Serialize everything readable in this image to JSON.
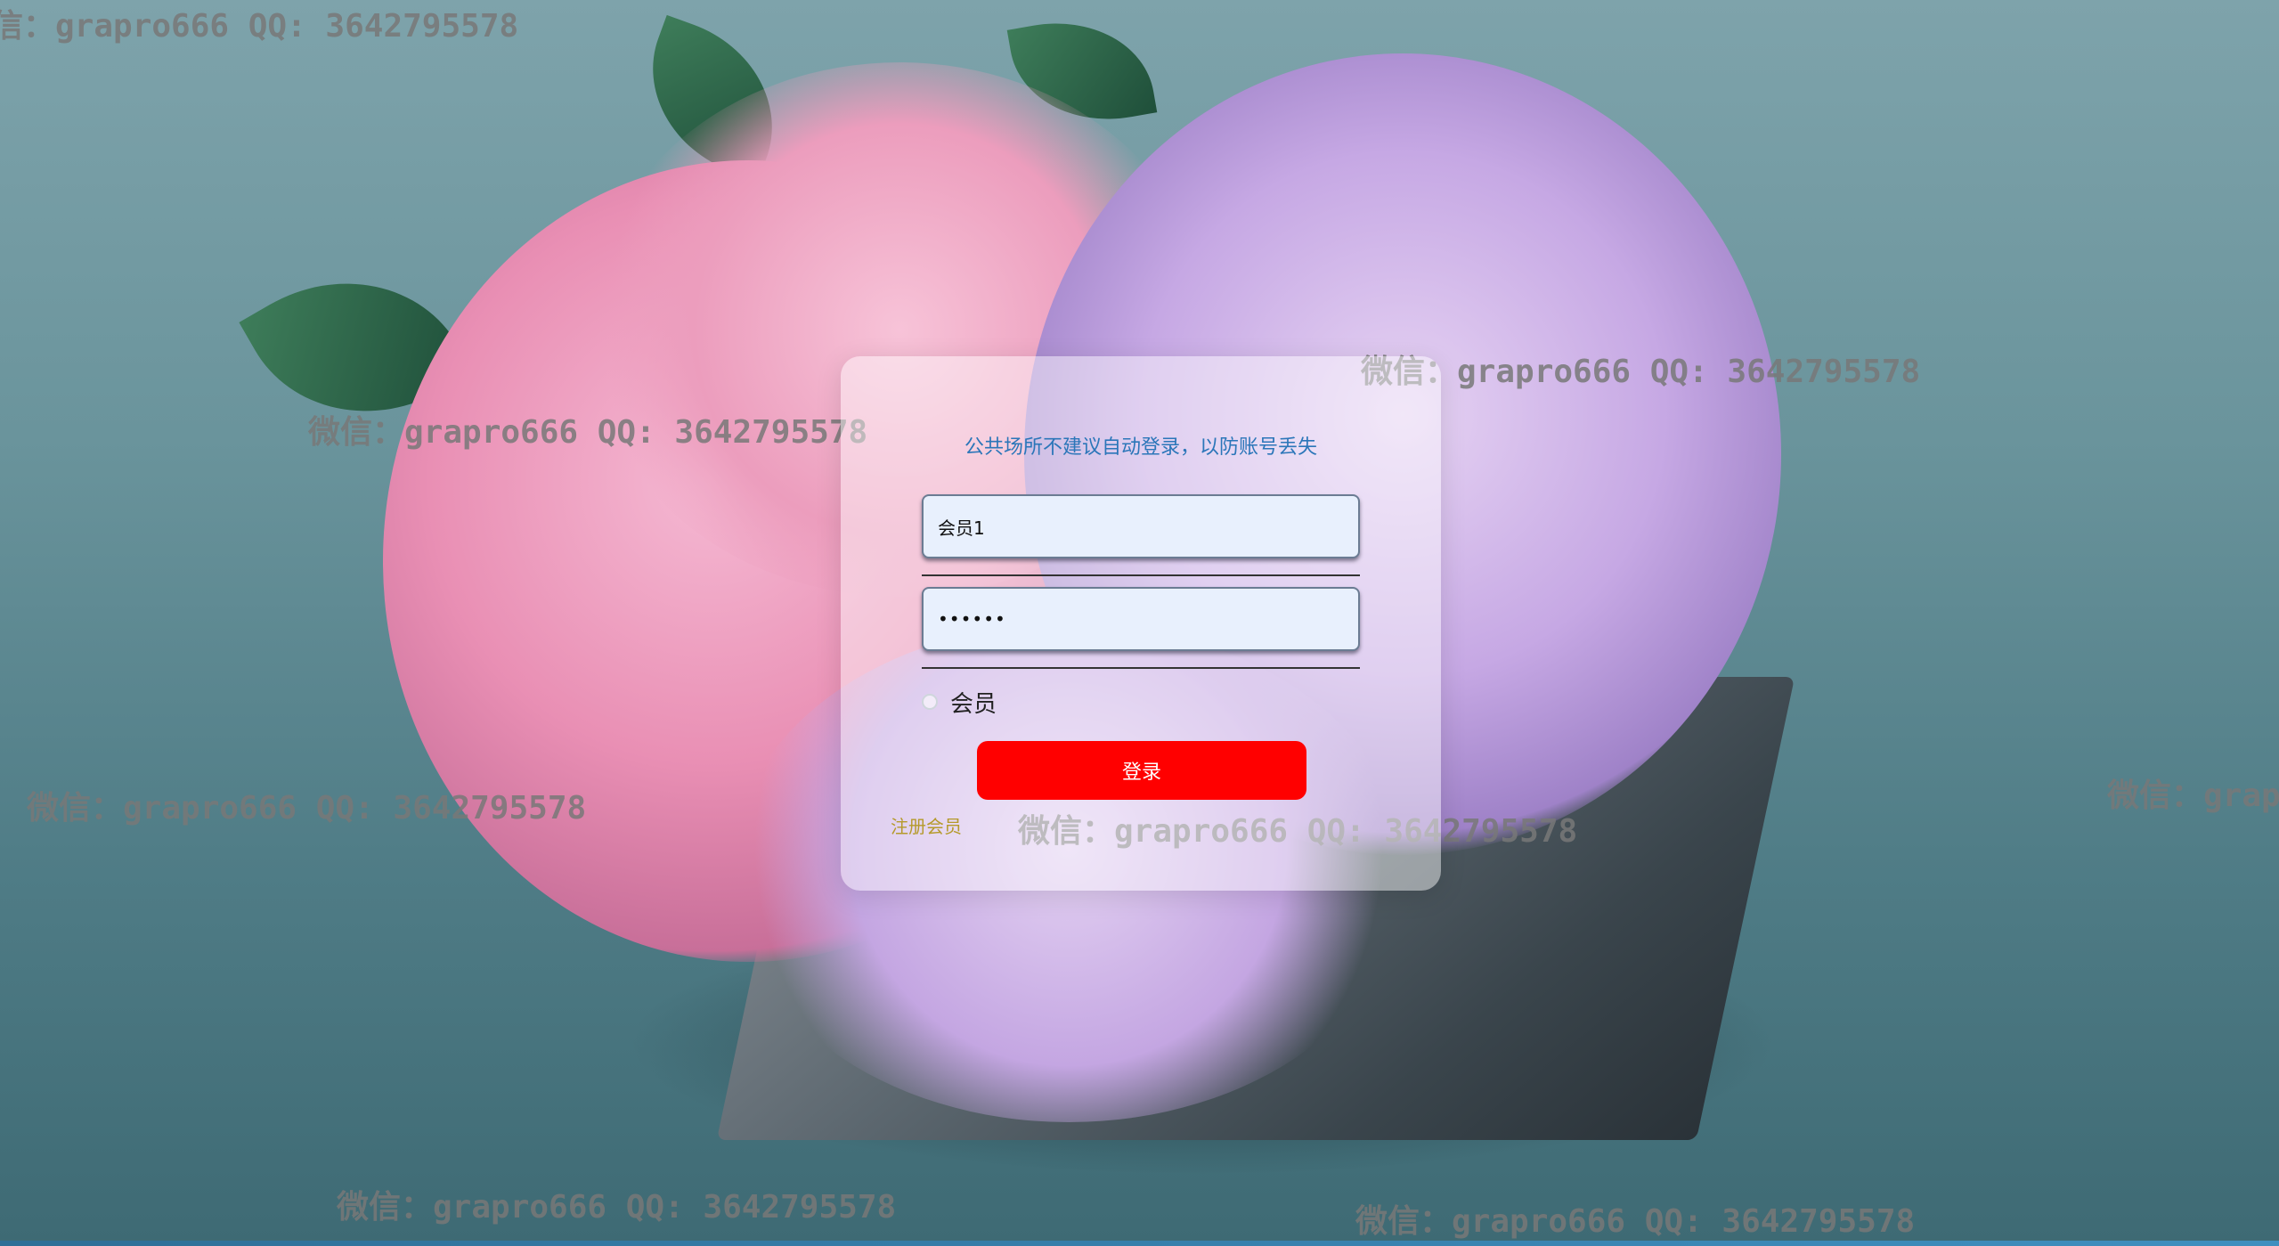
{
  "login": {
    "notice": "公共场所不建议自动登录，以防账号丢失",
    "username_value": "会员1",
    "password_value": "••••••",
    "role_option": "会员",
    "login_button": "登录",
    "register_link": "注册会员"
  },
  "watermarks": [
    "信：grapro666 QQ: 3642795578",
    "微信：grapro666 QQ: 3642795578",
    "微信：grapro666 QQ: 3642795578",
    "微信：grapro666 QQ: 3642795578",
    "微信：grapro666 QQ: 3642795578",
    "微信：grap",
    "微信：grapro666 QQ: 3642795578",
    "微信：grapro666 QQ: 3642795578"
  ],
  "colors": {
    "login_button": "#ff0000",
    "notice_text": "#2b76b9",
    "register_link": "#b59a2b",
    "field_background": "#e8f0fd"
  }
}
